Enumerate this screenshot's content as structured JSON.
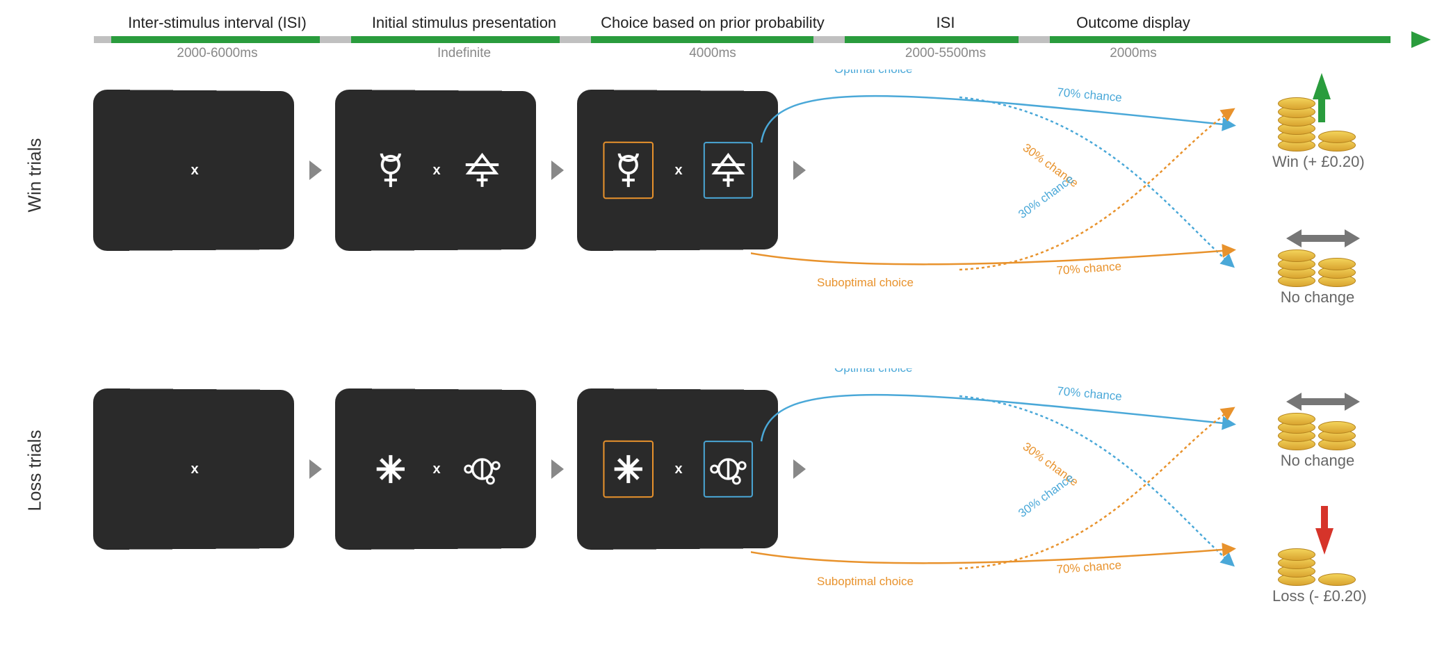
{
  "timeline": {
    "phases": [
      {
        "label": "Inter-stimulus interval (ISI)",
        "duration": "2000-6000ms"
      },
      {
        "label": "Initial stimulus presentation",
        "duration": "Indefinite"
      },
      {
        "label": "Choice based on prior probability",
        "duration": "4000ms"
      },
      {
        "label": "ISI",
        "duration": "2000-5500ms"
      },
      {
        "label": "Outcome display",
        "duration": "2000ms"
      }
    ]
  },
  "rows": {
    "win": {
      "title": "Win trials",
      "optimal_label": "Optimal choice",
      "suboptimal_label": "Suboptimal choice",
      "p_high": "70% chance",
      "p_low": "30% chance",
      "outcome_top": "Win (+ £0.20)",
      "outcome_bottom": "No change"
    },
    "loss": {
      "title": "Loss trials",
      "optimal_label": "Optimal choice",
      "suboptimal_label": "Suboptimal choice",
      "p_high": "70% chance",
      "p_low": "30% chance",
      "outcome_top": "No change",
      "outcome_bottom": "Loss (- £0.20)"
    }
  },
  "fixation": "x",
  "choice_colors": {
    "optimal": "#4aa8d8",
    "suboptimal": "#e8922c"
  },
  "probabilities": {
    "optimal_to_primary": 0.7,
    "optimal_to_secondary": 0.3,
    "suboptimal_to_primary": 0.3,
    "suboptimal_to_secondary": 0.7
  },
  "stimuli": {
    "win_left": "mercury-symbol",
    "win_right": "triangle-cross-symbol",
    "loss_left": "asterisk-symbol",
    "loss_right": "orb-symbol"
  }
}
